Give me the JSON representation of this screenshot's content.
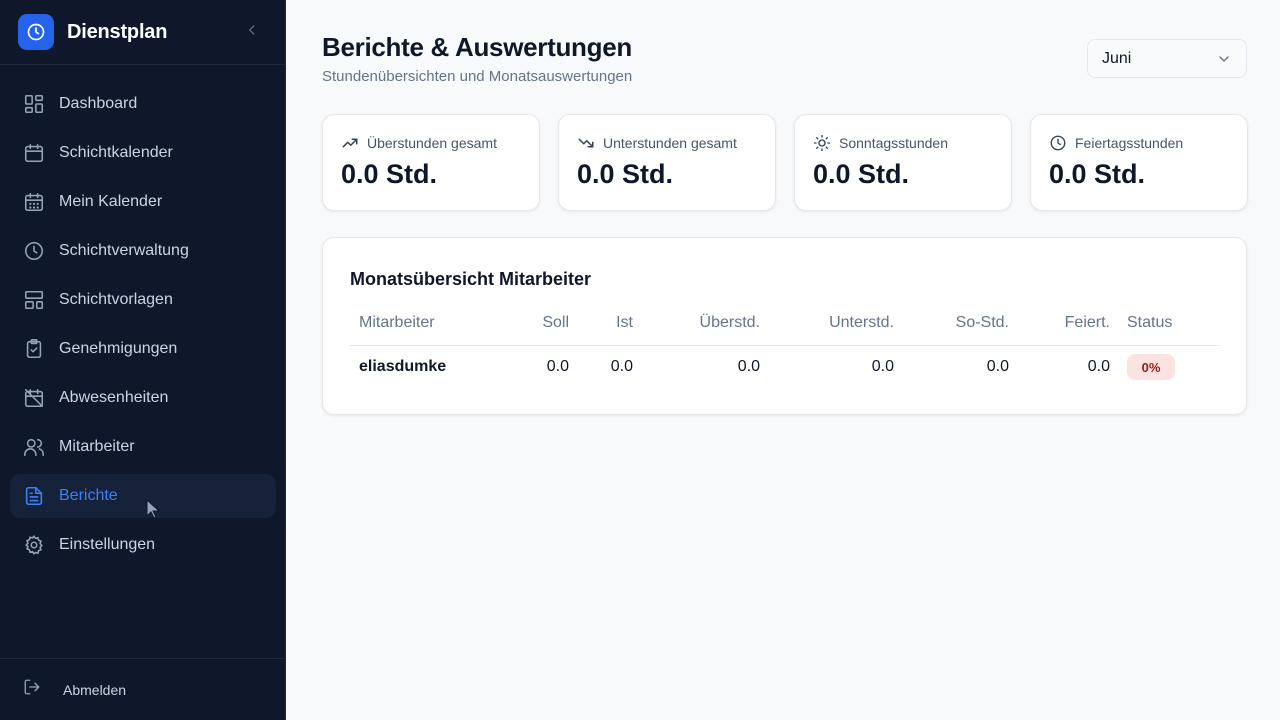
{
  "app": {
    "title": "Dienstplan"
  },
  "sidebar": {
    "items": [
      {
        "label": "Dashboard",
        "icon": "layout-grid-icon"
      },
      {
        "label": "Schichtkalender",
        "icon": "calendar-icon"
      },
      {
        "label": "Mein Kalender",
        "icon": "calendar-days-icon"
      },
      {
        "label": "Schichtverwaltung",
        "icon": "clock-icon"
      },
      {
        "label": "Schichtvorlagen",
        "icon": "layout-template-icon"
      },
      {
        "label": "Genehmigungen",
        "icon": "clipboard-check-icon"
      },
      {
        "label": "Abwesenheiten",
        "icon": "calendar-off-icon"
      },
      {
        "label": "Mitarbeiter",
        "icon": "users-icon"
      },
      {
        "label": "Berichte",
        "icon": "file-text-icon",
        "active": true
      },
      {
        "label": "Einstellungen",
        "icon": "gear-icon"
      }
    ],
    "logout_label": "Abmelden"
  },
  "header": {
    "title": "Berichte & Auswertungen",
    "subtitle": "Stundenübersichten und Monatsauswertungen",
    "month_select": {
      "value": "Juni"
    }
  },
  "stats": [
    {
      "label": "Überstunden gesamt",
      "value": "0.0 Std.",
      "icon": "trending-up-icon"
    },
    {
      "label": "Unterstunden gesamt",
      "value": "0.0 Std.",
      "icon": "trending-down-icon"
    },
    {
      "label": "Sonntagsstunden",
      "value": "0.0 Std.",
      "icon": "sun-icon"
    },
    {
      "label": "Feiertagsstunden",
      "value": "0.0 Std.",
      "icon": "clock-icon"
    }
  ],
  "table": {
    "title": "Monatsübersicht Mitarbeiter",
    "columns": [
      "Mitarbeiter",
      "Soll",
      "Ist",
      "Überstd.",
      "Unterstd.",
      "So-Std.",
      "Feiert.",
      "Status"
    ],
    "rows": [
      {
        "name": "eliasdumke",
        "soll": "0.0",
        "ist": "0.0",
        "ueberstd": "0.0",
        "unterstd": "0.0",
        "so_std": "0.0",
        "feiert": "0.0",
        "status": "0%"
      }
    ]
  },
  "colors": {
    "sidebar_bg": "#0f172a",
    "accent": "#2563eb",
    "active_text": "#3b82f6",
    "badge_bg": "#fde2e2",
    "badge_text": "#991b1b"
  }
}
